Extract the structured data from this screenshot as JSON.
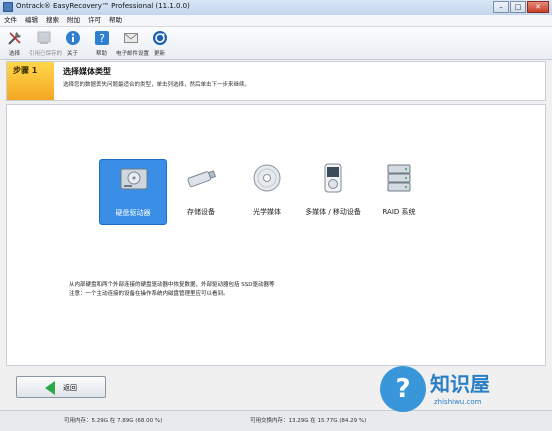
{
  "window": {
    "title": "Ontrack® EasyRecovery™ Professional (11.1.0.0)",
    "minimize": "–",
    "maximize": "□",
    "close": "✕"
  },
  "menu": [
    "文件",
    "编辑",
    "搜索",
    "附加",
    "许可",
    "帮助"
  ],
  "toolbar": [
    {
      "label": "选择",
      "icon": "tools-icon",
      "enabled": true
    },
    {
      "label": "引用已保存的",
      "icon": "scan-icon",
      "enabled": false
    },
    {
      "label": "关于",
      "icon": "info-icon",
      "enabled": true
    },
    {
      "label": "帮助",
      "icon": "help-icon",
      "enabled": true
    },
    {
      "label": "电子邮件设置",
      "icon": "email-icon",
      "enabled": true
    },
    {
      "label": "更新",
      "icon": "update-icon",
      "enabled": true
    }
  ],
  "step": {
    "badge": "步骤 1",
    "title": "选择媒体类型",
    "desc": "选择您的数据丢失问题最适合的类型，单击列选择，然后单击下一步来继续。"
  },
  "media": [
    {
      "label": "硬盘驱动器",
      "icon": "hard-drive-icon",
      "selected": true
    },
    {
      "label": "存储设备",
      "icon": "usb-drive-icon",
      "selected": false
    },
    {
      "label": "光学媒体",
      "icon": "optical-disc-icon",
      "selected": false
    },
    {
      "label": "多媒体 / 移动设备",
      "icon": "media-player-icon",
      "selected": false
    },
    {
      "label": "RAID 系统",
      "icon": "raid-icon",
      "selected": false
    }
  ],
  "description": {
    "line1": "从内部硬盘和两个外部连接的硬盘驱动器中恢复数据，外部驱动器包括 SSD驱动器等",
    "line2": "注意：一个主动连接的设备在操作系统内磁盘管理里应可以看到。"
  },
  "buttons": {
    "back": "返回"
  },
  "status": {
    "left": "可用内存：5.29G 在 7.89G (68.00 %)",
    "right": "可用交换内存：13.29G 在 15.77G (84.29 %)"
  },
  "watermark": {
    "title": "知识屋",
    "url": "zhishiwu.com",
    "symbol": "?"
  },
  "colors": {
    "accent": "#3a8ee6",
    "step_badge": "#f5a623",
    "back_arrow": "#2fa84a",
    "watermark": "#2a8fd6"
  }
}
